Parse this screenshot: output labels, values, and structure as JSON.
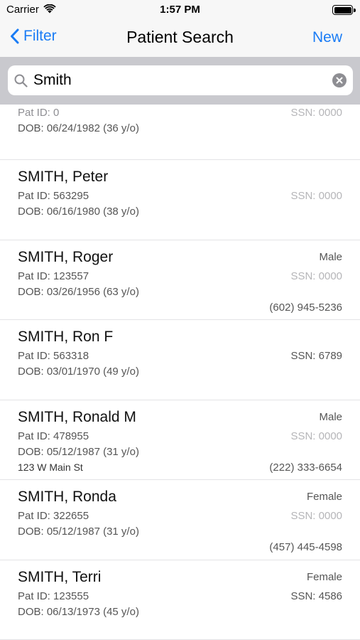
{
  "status": {
    "carrier": "Carrier",
    "time": "1:57 PM"
  },
  "nav": {
    "back_label": "Filter",
    "title": "Patient Search",
    "new_label": "New"
  },
  "search": {
    "value": "Smith",
    "placeholder": ""
  },
  "first_partial": {
    "patid": "Pat ID: 0",
    "dob": "DOB: 06/24/1982 (36 y/o)",
    "ssn": "SSN: 0000"
  },
  "patients": [
    {
      "name": "SMITH, Peter",
      "patid": "Pat ID: 563295",
      "dob": "DOB: 06/16/1980 (38 y/o)",
      "gender": "",
      "ssn": "SSN: 0000",
      "ssn_known": false,
      "address": "",
      "phone": ""
    },
    {
      "name": "SMITH, Roger",
      "patid": "Pat ID: 123557",
      "dob": "DOB: 03/26/1956 (63 y/o)",
      "gender": "Male",
      "ssn": "SSN: 0000",
      "ssn_known": false,
      "address": "",
      "phone": "(602) 945-5236"
    },
    {
      "name": "SMITH, Ron F",
      "patid": "Pat ID: 563318",
      "dob": "DOB: 03/01/1970 (49 y/o)",
      "gender": "",
      "ssn": "SSN: 6789",
      "ssn_known": true,
      "address": "",
      "phone": ""
    },
    {
      "name": "SMITH, Ronald M",
      "patid": "Pat ID: 478955",
      "dob": "DOB: 05/12/1987 (31 y/o)",
      "gender": "Male",
      "ssn": "SSN: 0000",
      "ssn_known": false,
      "address": "123 W Main St",
      "phone": "(222) 333-6654"
    },
    {
      "name": "SMITH, Ronda",
      "patid": "Pat ID: 322655",
      "dob": "DOB: 05/12/1987 (31 y/o)",
      "gender": "Female",
      "ssn": "SSN: 0000",
      "ssn_known": false,
      "address": "",
      "phone": "(457) 445-4598"
    },
    {
      "name": "SMITH, Terri",
      "patid": "Pat ID: 123555",
      "dob": "DOB: 06/13/1973 (45 y/o)",
      "gender": "Female",
      "ssn": "SSN: 4586",
      "ssn_known": true,
      "address": "",
      "phone": ""
    }
  ],
  "colors": {
    "accent": "#1a7cf5",
    "bar_background": "#f7f7f7",
    "search_background": "#c9c9ce"
  }
}
